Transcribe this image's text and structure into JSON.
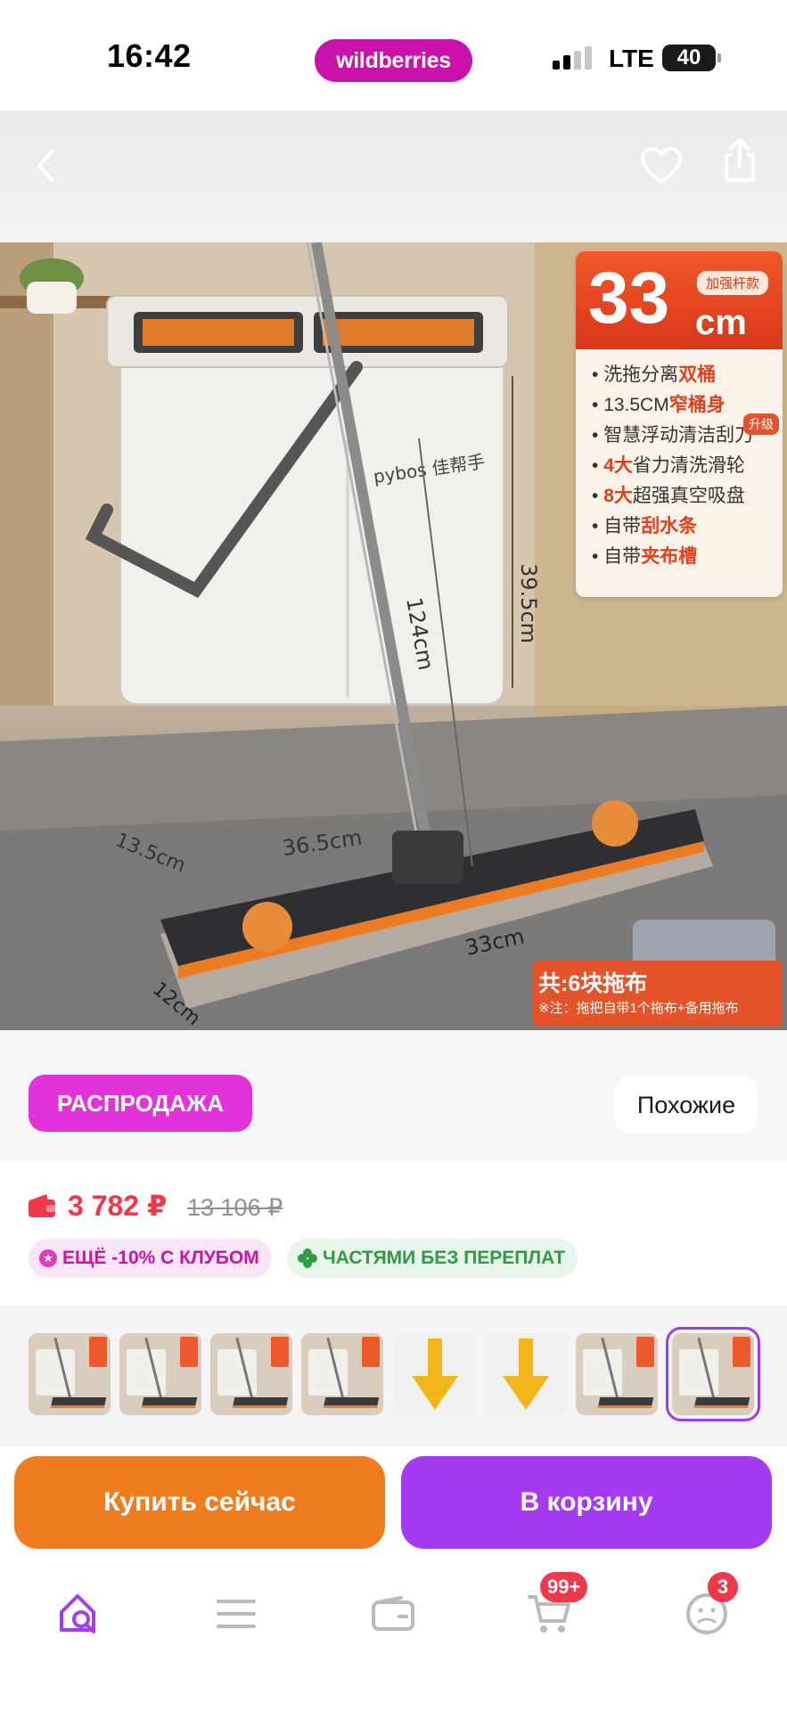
{
  "status_bar": {
    "time": "16:42",
    "brand": "wildberries",
    "network": "LTE",
    "battery": "40"
  },
  "nav": {
    "back_icon": "chevron-left-icon",
    "favorite_icon": "heart-icon",
    "share_icon": "share-icon"
  },
  "product_image": {
    "badge": {
      "size_number": "33",
      "size_unit": "cm",
      "tag": "加强杆款",
      "features": [
        {
          "text": "洗拖分离",
          "highlight": "双桶"
        },
        {
          "text": "13.5CM",
          "highlight": "窄桶身"
        },
        {
          "text": "智慧浮动清洁刮刀",
          "highlight": ""
        },
        {
          "text": "省力清洗滑轮",
          "highlight": "4大"
        },
        {
          "text": "超强真空吸盘",
          "highlight": "8大"
        },
        {
          "text": "自带",
          "highlight": "刮水条"
        },
        {
          "text": "自带",
          "highlight": "夹布槽"
        }
      ],
      "upgrade_label": "升级"
    },
    "dimensions": {
      "height": "39.5cm",
      "handle": "124cm",
      "width": "36.5cm",
      "depth": "13.5cm",
      "pad_width": "33cm",
      "pad_depth": "12cm"
    },
    "bucket_brand": "pybos 佳帮手",
    "pads_card": {
      "title": "共:6块拖布",
      "note": "※注：拖把自带1个拖布+备用拖布"
    }
  },
  "sale": {
    "label": "РАСПРОДАЖА",
    "similar_label": "Похожие"
  },
  "price": {
    "current": "3 782 ₽",
    "old": "13 106 ₽",
    "club_pill": "ЕЩЁ -10% С КЛУБОМ",
    "installments_pill": "ЧАСТЯМИ БЕЗ ПЕРЕПЛАТ"
  },
  "thumbnails": {
    "count": 8,
    "active_index": 7
  },
  "actions": {
    "buy_now": "Купить сейчас",
    "add_to_cart": "В корзину"
  },
  "tab_bar": {
    "cart_badge": "99+",
    "profile_badge": "3"
  },
  "colors": {
    "brand": "#cb11ab",
    "sale_pill": "#e233db",
    "price": "#f0384a",
    "buy_button": "#f07c20",
    "cart_button": "#a43bf0",
    "club_text": "#cb11ab",
    "installments_text": "#2f9a48"
  }
}
